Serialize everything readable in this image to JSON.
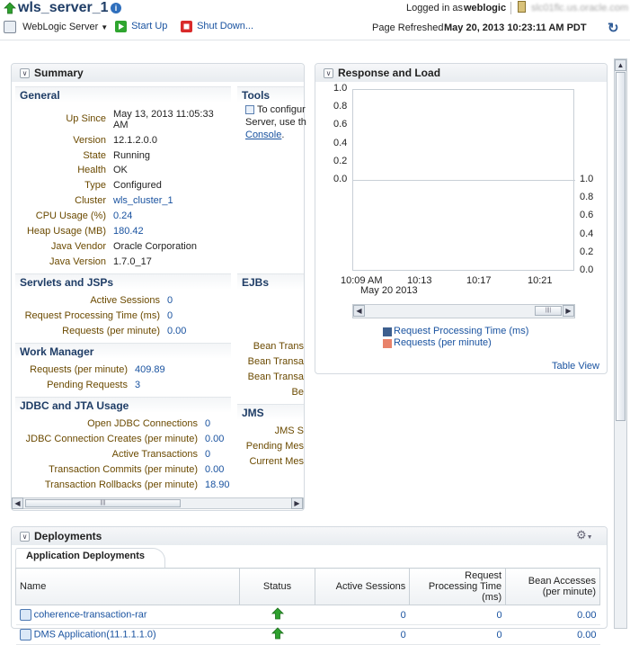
{
  "header": {
    "server_name": "wls_server_1",
    "logged_in_label": "Logged in as",
    "username": "weblogic",
    "host": "slc01flc.us.oracle.com",
    "menu_label": "WebLogic Server",
    "start_label": "Start Up",
    "shutdown_label": "Shut Down...",
    "page_refreshed_label": "Page Refreshed",
    "page_refreshed_value": "May 20, 2013 10:23:11 AM PDT"
  },
  "summary": {
    "title": "Summary",
    "general": {
      "title": "General",
      "rows": [
        {
          "label": "Up Since",
          "value": "May 13, 2013 11:05:33",
          "value2": "AM"
        },
        {
          "label": "Version",
          "value": "12.1.2.0.0"
        },
        {
          "label": "State",
          "value": "Running"
        },
        {
          "label": "Health",
          "value": "OK"
        },
        {
          "label": "Type",
          "value": "Configured"
        },
        {
          "label": "Cluster",
          "value": "wls_cluster_1"
        },
        {
          "label": "CPU Usage (%)",
          "value": "0.24"
        },
        {
          "label": "Heap Usage (MB)",
          "value": "180.42"
        },
        {
          "label": "Java Vendor",
          "value": "Oracle Corporation"
        },
        {
          "label": "Java Version",
          "value": "1.7.0_17"
        }
      ]
    },
    "tools": {
      "title": "Tools",
      "line1": "To configur",
      "line2": "Server, use th",
      "link": "Console",
      "tail": "."
    },
    "servlets": {
      "title": "Servlets and JSPs",
      "rows": [
        {
          "label": "Active Sessions",
          "value": "0"
        },
        {
          "label": "Request Processing Time (ms)",
          "value": "0"
        },
        {
          "label": "Requests (per minute)",
          "value": "0.00"
        }
      ]
    },
    "ejbs": {
      "title": "EJBs",
      "rows": [
        "Bean Trans",
        "Bean Transa",
        "Bean Transa",
        "Be"
      ]
    },
    "work_manager": {
      "title": "Work Manager",
      "rows": [
        {
          "label": "Requests (per minute)",
          "value": "409.89"
        },
        {
          "label": "Pending Requests",
          "value": "3"
        }
      ]
    },
    "jdbc": {
      "title": "JDBC and JTA Usage",
      "rows": [
        {
          "label": "Open JDBC Connections",
          "value": "0"
        },
        {
          "label": "JDBC Connection Creates (per minute)",
          "value": "0.00"
        },
        {
          "label": "Active Transactions",
          "value": "0"
        },
        {
          "label": "Transaction Commits (per minute)",
          "value": "0.00"
        },
        {
          "label": "Transaction Rollbacks (per minute)",
          "value": "18.90"
        }
      ]
    },
    "jms": {
      "title": "JMS",
      "rows": [
        "JMS S",
        "Pending Mes",
        "Current Mes"
      ]
    }
  },
  "response": {
    "title": "Response and Load",
    "table_view": "Table View"
  },
  "chart_data": {
    "type": "line",
    "x": [
      "10:09 AM",
      "10:13",
      "10:17",
      "10:21"
    ],
    "x_sublabel": "May 20 2013",
    "left_axis_ticks": [
      "1.0",
      "0.8",
      "0.6",
      "0.4",
      "0.2",
      "0.0"
    ],
    "right_axis_ticks": [
      "1.0",
      "0.8",
      "0.6",
      "0.4",
      "0.2",
      "0.0"
    ],
    "series": [
      {
        "name": "Request Processing Time (ms)",
        "color": "#3d5f8e",
        "values": [
          0,
          0,
          0,
          0
        ]
      },
      {
        "name": "Requests (per minute)",
        "color": "#e8826a",
        "values": [
          0,
          0,
          0,
          0
        ]
      }
    ],
    "ylim_left": [
      0,
      1.0
    ],
    "ylim_right": [
      0,
      1.0
    ]
  },
  "deployments": {
    "title": "Deployments",
    "tab": "Application Deployments",
    "columns": [
      "Name",
      "Status",
      "Active Sessions",
      "Request Processing Time (ms)",
      "Bean Accesses (per minute)"
    ],
    "rows": [
      {
        "name": "coherence-transaction-rar",
        "active": "0",
        "rpt": "0",
        "bean": "0.00"
      },
      {
        "name": "DMS Application(11.1.1.1.0)",
        "active": "0",
        "rpt": "0",
        "bean": "0.00"
      }
    ]
  }
}
